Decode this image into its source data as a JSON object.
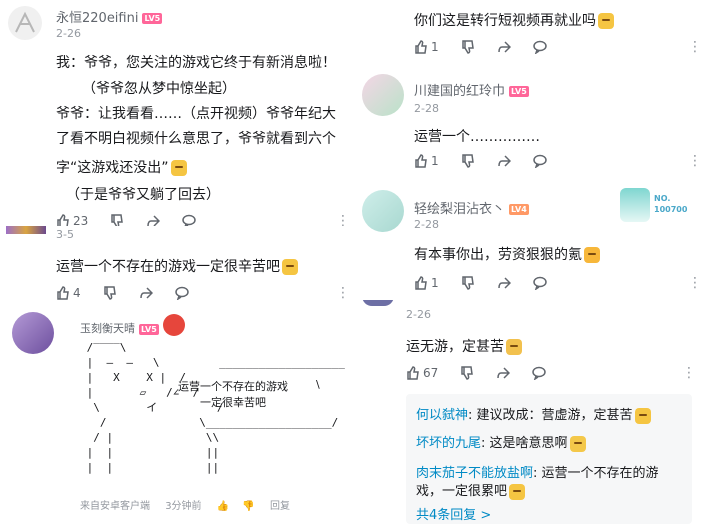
{
  "comment1": {
    "username": "永恒220eifini",
    "level": "LV5",
    "date": "2-26",
    "lines": [
      "我：爷爷，您关注的游戏它终于有新消息啦！",
      "（爷爷忽从梦中惊坐起）",
      "爷爷：让我看看……（点开视频）爷爷年纪大",
      "了看不明白视频什么意思了，爷爷就看到六个",
      "字“这游戏还没出”",
      "（于是爷爷又躺了回去）"
    ],
    "likes": "23"
  },
  "comment2": {
    "date": "3-5",
    "text": "运营一个不存在的游戏一定很辛苦吧",
    "likes": "4"
  },
  "comment3": {
    "username": "玉刻衡天晴",
    "level": "LV5",
    "ascii_bubble_line1": "运营一个不存在的游戏",
    "ascii_bubble_line2": "一定很幸苦吧",
    "footer_source": "来自安卓客户端",
    "footer_time": "3分钟前",
    "footer_reply": "回复"
  },
  "comment4": {
    "text": "你们这是转行短视频再就业吗",
    "likes": "1"
  },
  "comment5": {
    "username": "川建国的红玲巾",
    "level": "LV5",
    "date": "2-28",
    "text": "运营一个……………",
    "likes": "1"
  },
  "comment6": {
    "username": "轻绘梨泪沾衣丶",
    "level": "LV4",
    "date": "2-28",
    "text": "有本事你出，劳资狠狠的氪",
    "likes": "1",
    "badge_no_label": "NO.",
    "badge_no_value": "100700"
  },
  "comment7": {
    "date": "2-26",
    "text": "运无游，定甚苦",
    "likes": "67",
    "replies": [
      {
        "user": "何以弑神",
        "text": ": 建议改成：营虚游，定甚苦"
      },
      {
        "user": "坏坏的九尾",
        "text": ": 这是啥意思啊"
      },
      {
        "user": "肉末茄子不能放盐啊",
        "text": ": 运营一个不存在的游",
        "cont": "戏，一定很累吧"
      }
    ],
    "more_replies": "共4条回复 >"
  },
  "icons": {
    "like": "thumb-up-icon",
    "dislike": "thumb-down-icon",
    "share": "share-arrow-icon",
    "reply": "comment-bubble-icon",
    "more": "more-vertical-icon"
  }
}
